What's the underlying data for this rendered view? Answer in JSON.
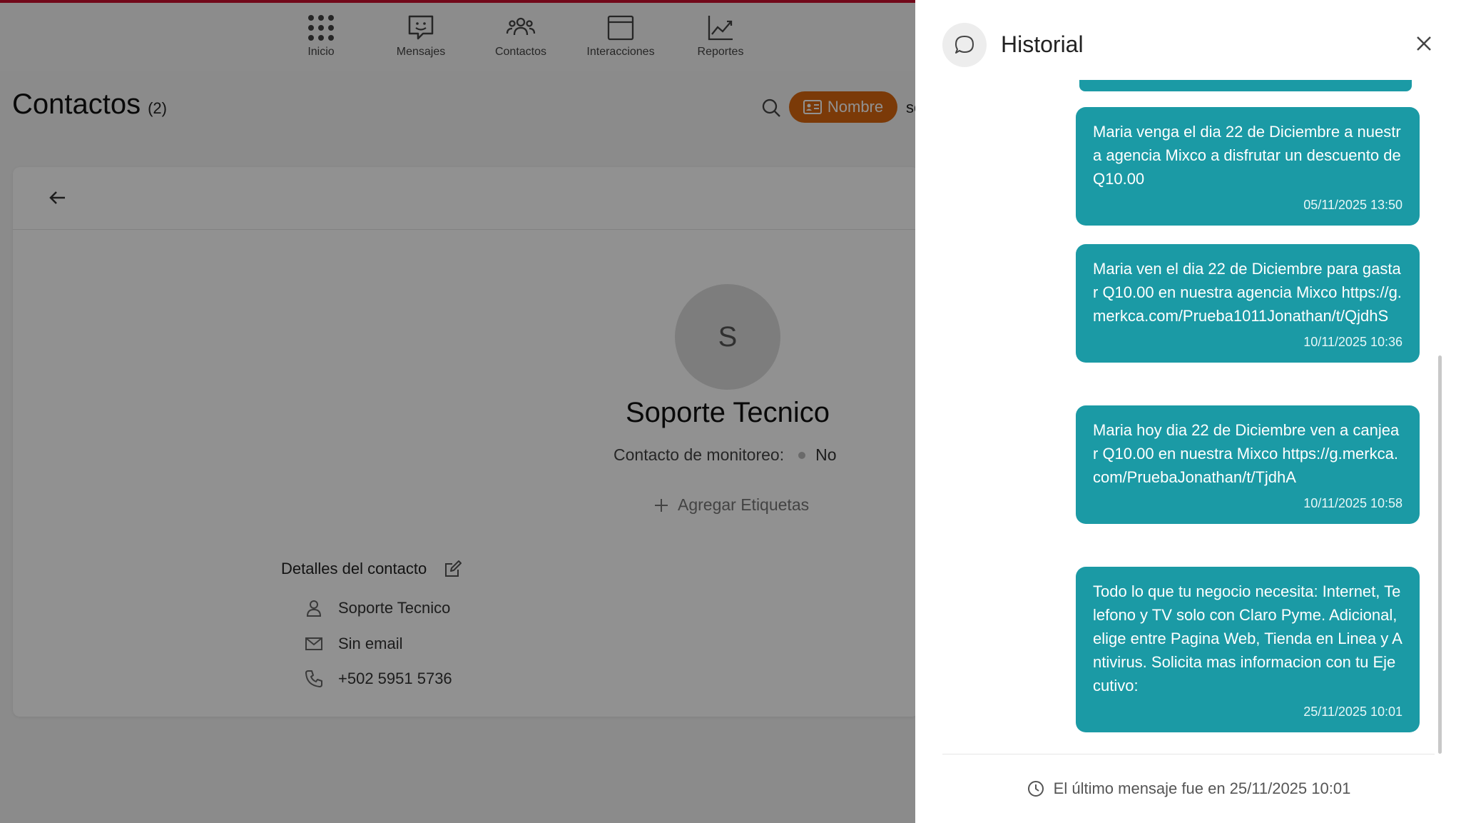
{
  "nav": {
    "items": [
      {
        "label": "Inicio",
        "icon": "grid-icon"
      },
      {
        "label": "Mensajes",
        "icon": "message-icon"
      },
      {
        "label": "Contactos",
        "icon": "contacts-icon"
      },
      {
        "label": "Interacciones",
        "icon": "window-icon"
      },
      {
        "label": "Reportes",
        "icon": "chart-icon"
      }
    ]
  },
  "page": {
    "title": "Contactos",
    "count": "(2)",
    "filter_label": "Nombre",
    "filter_next": "so"
  },
  "contact": {
    "avatar_initial": "S",
    "name": "Soporte Tecnico",
    "monitor_label": "Contacto de monitoreo:",
    "monitor_value": "No",
    "add_tags": "Agregar Etiquetas",
    "details_title": "Detalles del contacto",
    "detail_name": "Soporte Tecnico",
    "detail_email": "Sin email",
    "detail_phone": "+502 5951 5736"
  },
  "drawer": {
    "title": "Historial",
    "messages": [
      {
        "text": "Maria venga el dia 22 de Diciembre a nuestra agencia Mixco a disfrutar un descuento de Q10.00",
        "time": "05/11/2025 13:50"
      },
      {
        "text": "Maria ven el dia 22 de Diciembre para gastar Q10.00 en nuestra agencia Mixco https://g.merkca.com/Prueba1011Jonathan/t/QjdhS",
        "time": "10/11/2025 10:36"
      },
      {
        "text": "Maria hoy dia 22 de Diciembre ven a canjear Q10.00 en nuestra Mixco https://g.merkca.com/PruebaJonathan/t/TjdhA",
        "time": "10/11/2025 10:58"
      },
      {
        "text": "Todo lo que tu negocio necesita: Internet, Telefono y TV solo con Claro Pyme. Adicional, elige entre Pagina Web, Tienda en Linea y Antivirus. Solicita mas informacion con tu Ejecutivo:",
        "time": "25/11/2025 10:01"
      }
    ],
    "footer": "El último mensaje fue en 25/11/2025 10:01"
  },
  "colors": {
    "bubble": "#1b9aa5",
    "filter_pill": "#d9660f",
    "top_accent": "#c8102e"
  }
}
